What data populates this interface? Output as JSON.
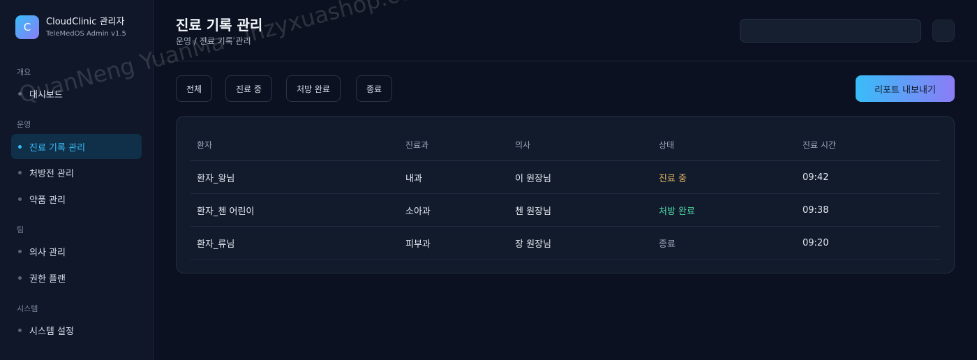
{
  "app": {
    "logo_letter": "C",
    "title": "CloudClinic 관리자",
    "subtitle": "TeleMedOS Admin v1.5"
  },
  "sidebar": {
    "sections": [
      {
        "label": "개요",
        "items": [
          {
            "label": "대시보드",
            "active": false
          }
        ]
      },
      {
        "label": "운영",
        "items": [
          {
            "label": "진료 기록 관리",
            "active": true
          },
          {
            "label": "처방전 관리",
            "active": false
          },
          {
            "label": "약품 관리",
            "active": false
          }
        ]
      },
      {
        "label": "팀",
        "items": [
          {
            "label": "의사 관리",
            "active": false
          },
          {
            "label": "권한 플랜",
            "active": false
          }
        ]
      },
      {
        "label": "시스템",
        "items": [
          {
            "label": "시스템 설정",
            "active": false
          }
        ]
      }
    ]
  },
  "header": {
    "title": "진료 기록 관리",
    "breadcrumb": "운영 / 진료 기록 관리",
    "search_value": ""
  },
  "filters": [
    "전체",
    "진료 중",
    "처방 완료",
    "종료"
  ],
  "export_label": "리포트 내보내기",
  "table": {
    "columns": [
      "환자",
      "진료과",
      "의사",
      "상태",
      "진료 시간"
    ],
    "rows": [
      {
        "patient": "환자_왕님",
        "dept": "내과",
        "doctor": "이 원장님",
        "status": "진료 중",
        "time": "09:42"
      },
      {
        "patient": "환자_첸 어린이",
        "dept": "소아과",
        "doctor": "첸 원장님",
        "status": "처방 완료",
        "time": "09:38"
      },
      {
        "patient": "환자_류님",
        "dept": "피부과",
        "doctor": "장 원장님",
        "status": "종료",
        "time": "09:20"
      }
    ]
  },
  "status_colors": {
    "in_progress": "#e5b862",
    "prescribed": "#4fd6a5",
    "ended": "#9aa5b8"
  },
  "watermark": "QuanNeng YuanMa · inzyxuashop.com"
}
